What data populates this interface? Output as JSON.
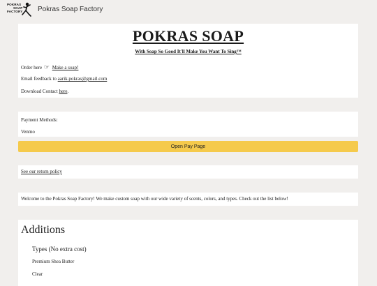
{
  "header": {
    "logo_lines": [
      "POKRAS",
      "SOAP",
      "FACTORY"
    ],
    "title": "Pokras Soap Factory"
  },
  "intro": {
    "title": "POKRAS SOAP",
    "tagline": "With Soap So Good It'll Make You Want To Sing™",
    "order_prefix": "Order here",
    "order_icon": "☞",
    "order_link": "Make a soap!",
    "email_prefix": "Email feedback to",
    "email_link": "aarik.pokras@gmail.com",
    "download_prefix": "Download Contact",
    "download_link": "here",
    "download_suffix": "."
  },
  "payment": {
    "label": "Payment Methods:",
    "method": "Venmo",
    "button_label": "Open Pay Page",
    "button_color": "#f5ca4c"
  },
  "return_policy": {
    "link": "See our return policy"
  },
  "welcome": {
    "text": "Welcome to the Pokras Soap Factory! We make custom soap with our wide variety of scents, colors, and types. Check out the list below!"
  },
  "additions": {
    "title": "Additions",
    "types_title": "Types (No extra cost)",
    "types": [
      "Premium Shea Butter",
      "Clear"
    ]
  }
}
